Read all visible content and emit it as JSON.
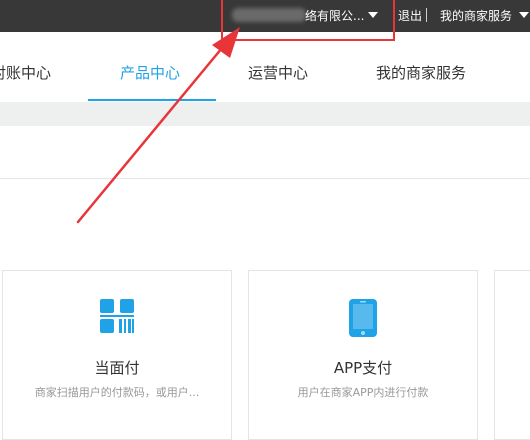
{
  "header": {
    "company": "络有限公...",
    "logout": "退出",
    "my_service": "我的商家服务"
  },
  "nav": {
    "tabs": [
      {
        "label": "对账中心"
      },
      {
        "label": "产品中心",
        "active": true
      },
      {
        "label": "运营中心"
      },
      {
        "label": "我的商家服务"
      }
    ]
  },
  "products": [
    {
      "title": "当面付",
      "desc": "商家扫描用户的付款码，或用户...",
      "icon": "qrcode-scan-icon"
    },
    {
      "title": "APP支付",
      "desc": "用户在商家APP内进行付款",
      "icon": "mobile-phone-icon"
    }
  ],
  "colors": {
    "accent": "#1fa2e6",
    "annotation": "#e8353a",
    "topbar": "#383838"
  }
}
